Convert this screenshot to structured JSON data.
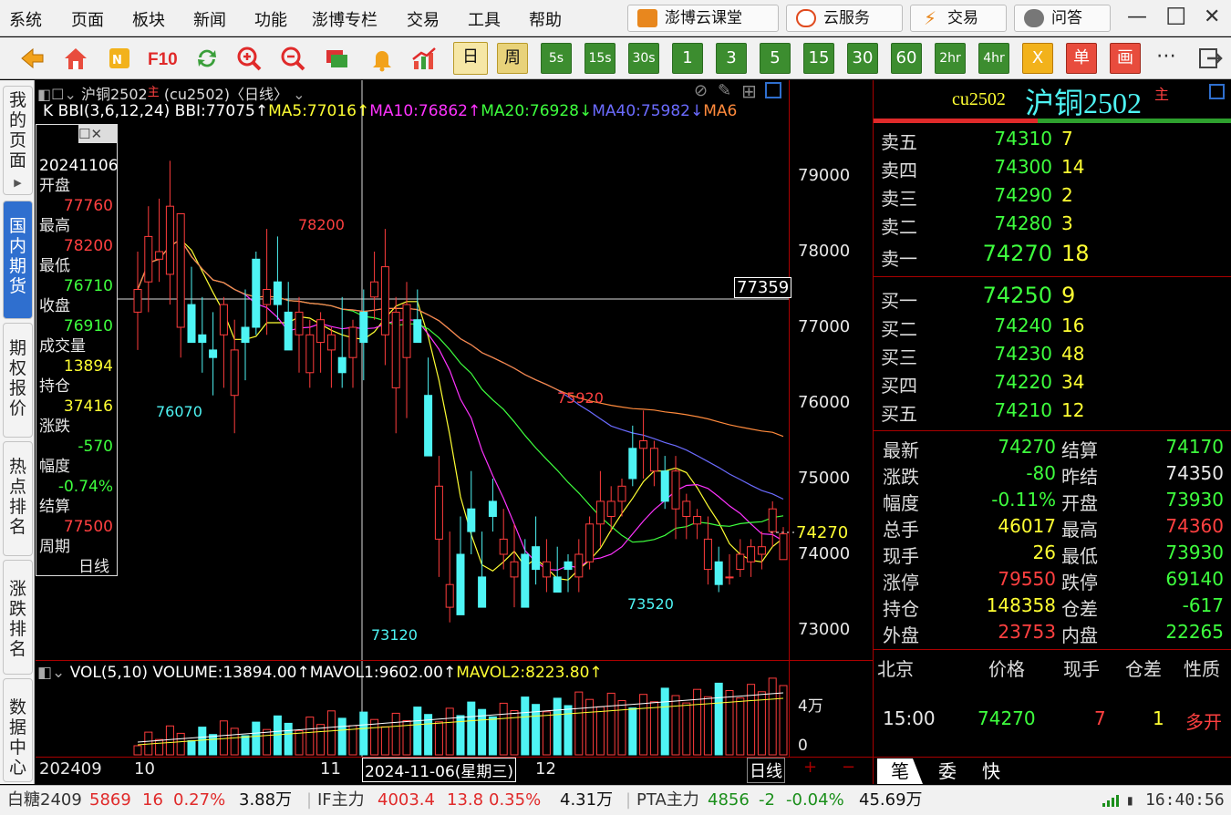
{
  "menu": [
    "系统",
    "页面",
    "板块",
    "新闻",
    "功能",
    "澎博专栏",
    "交易",
    "工具",
    "帮助"
  ],
  "top_buttons": {
    "ketang": "澎博云课堂",
    "yun": "云服务",
    "jiaoyi": "交易",
    "wenda": "问答"
  },
  "periods": [
    "日",
    "周",
    "5s",
    "15s",
    "30s",
    "1",
    "3",
    "5",
    "15",
    "30",
    "60",
    "2hr",
    "4hr",
    "X",
    "单",
    "画"
  ],
  "toolbar_icons": [
    "back-arrow-icon",
    "home-icon",
    "f10-news-icon",
    "f10-icon",
    "refresh-icon",
    "zoom-in-icon",
    "zoom-out-icon",
    "window-icon",
    "alert-bell-icon",
    "trend-icon"
  ],
  "sidebar": [
    "我的页面",
    "国内期货",
    "期权报价",
    "热点排名",
    "涨跌排名",
    "数据中心"
  ],
  "chart": {
    "header_title": "沪铜2502",
    "header_main": "主",
    "header_code": "(cu2502)",
    "header_period": "〈日线〉",
    "indicator_prefix": "K",
    "bbi": "BBI(3,6,12,24) BBI:77075↑",
    "ma5": "MA5:77016↑",
    "ma10": "MA10:76862↑",
    "ma20": "MA20:76928↓",
    "ma40": "MA40:75982↓",
    "ma_more": "MA6",
    "price_axis": [
      "79000",
      "78000",
      "77000",
      "76000",
      "75000",
      "74000",
      "73000"
    ],
    "cursor_price": "77359",
    "last_price": "74270",
    "annotations": {
      "high1": "78200",
      "low1": "76070",
      "high2": "75920",
      "low2": "73120",
      "low3": "73520"
    },
    "vol_header": {
      "vol": "VOL(5,10) VOLUME:13894.00↑",
      "mavol1": "MAVOL1:9602.00↑",
      "mavol2": "MAVOL2:8223.80↑"
    },
    "vol_axis": [
      "4万",
      "0"
    ],
    "date_axis": [
      "202409",
      "10",
      "11",
      "12"
    ],
    "cursor_date": "2024-11-06(星期三)",
    "period_label": "日线"
  },
  "chart_data": {
    "type": "candlestick",
    "title": "沪铜2502 (cu2502) 日线",
    "ylim": [
      72400,
      79900
    ],
    "ohlc": [
      [
        77200,
        78000,
        76700,
        77500
      ],
      [
        77600,
        78600,
        77200,
        78200
      ],
      [
        77900,
        78700,
        77600,
        78000
      ],
      [
        77700,
        79200,
        77300,
        78600
      ],
      [
        77000,
        78200,
        76600,
        78500
      ],
      [
        77300,
        77800,
        76900,
        76800
      ],
      [
        76900,
        77400,
        76400,
        76800
      ],
      [
        76700,
        77200,
        76100,
        76600
      ],
      [
        76900,
        77400,
        76200,
        77300
      ],
      [
        76100,
        77100,
        75600,
        76700
      ],
      [
        77000,
        77500,
        76300,
        76800
      ],
      [
        77900,
        78000,
        76900,
        77000
      ],
      [
        77300,
        78300,
        76900,
        77500
      ],
      [
        77600,
        78200,
        77100,
        77300
      ],
      [
        77200,
        77600,
        76700,
        76700
      ],
      [
        76900,
        77400,
        76400,
        77200
      ],
      [
        76400,
        77100,
        76200,
        76900
      ],
      [
        76800,
        77200,
        76400,
        77100
      ],
      [
        76700,
        77000,
        76200,
        76900
      ],
      [
        76600,
        77400,
        76200,
        76400
      ],
      [
        76600,
        77100,
        76200,
        77000
      ],
      [
        77200,
        77500,
        76300,
        76800
      ],
      [
        77400,
        78000,
        77100,
        77600
      ],
      [
        76900,
        78300,
        76500,
        77800
      ],
      [
        76200,
        77400,
        75600,
        77200
      ],
      [
        76600,
        77600,
        75800,
        77300
      ],
      [
        77100,
        77500,
        76800,
        76800
      ],
      [
        76100,
        76600,
        75400,
        75300
      ],
      [
        74200,
        75300,
        73700,
        74900
      ],
      [
        73300,
        74300,
        73100,
        73600
      ],
      [
        74000,
        74500,
        73300,
        73200
      ],
      [
        74600,
        75100,
        74000,
        74300
      ],
      [
        73700,
        74300,
        73400,
        73300
      ],
      [
        74700,
        75000,
        74300,
        74500
      ],
      [
        74000,
        74600,
        73800,
        74200
      ],
      [
        73700,
        74400,
        73300,
        73900
      ],
      [
        74000,
        74200,
        73400,
        73300
      ],
      [
        74100,
        74500,
        73600,
        73800
      ],
      [
        73700,
        74200,
        73500,
        73900
      ],
      [
        73700,
        74100,
        73600,
        73500
      ],
      [
        73900,
        74000,
        73500,
        73800
      ],
      [
        73700,
        74200,
        73500,
        74000
      ],
      [
        73900,
        74500,
        73800,
        74400
      ],
      [
        74400,
        75100,
        74100,
        74700
      ],
      [
        74500,
        74900,
        74300,
        74700
      ],
      [
        74700,
        75000,
        74500,
        74900
      ],
      [
        75400,
        75700,
        74900,
        75000
      ],
      [
        75400,
        75900,
        75000,
        75500
      ],
      [
        75100,
        75500,
        74900,
        75400
      ],
      [
        75100,
        75300,
        74600,
        74700
      ],
      [
        74600,
        75300,
        74200,
        75100
      ],
      [
        74500,
        74800,
        74200,
        74700
      ],
      [
        74400,
        74600,
        74200,
        74500
      ],
      [
        73800,
        74500,
        73600,
        74200
      ],
      [
        73900,
        74100,
        73500,
        73600
      ],
      [
        73700,
        74000,
        73600,
        73700
      ],
      [
        73800,
        74200,
        73700,
        74000
      ],
      [
        73900,
        74200,
        73700,
        74100
      ],
      [
        74000,
        74300,
        73800,
        74100
      ],
      [
        74300,
        74700,
        74100,
        74600
      ],
      [
        73930,
        74360,
        73930,
        74270
      ]
    ],
    "volume_max_label": "4万"
  },
  "right": {
    "code": "cu2502",
    "name": "沪铜2502",
    "main": "主",
    "sell": [
      {
        "label": "卖五",
        "price": "74310",
        "vol": "7"
      },
      {
        "label": "卖四",
        "price": "74300",
        "vol": "14"
      },
      {
        "label": "卖三",
        "price": "74290",
        "vol": "2"
      },
      {
        "label": "卖二",
        "price": "74280",
        "vol": "3"
      },
      {
        "label": "卖一",
        "price": "74270",
        "vol": "18"
      }
    ],
    "buy": [
      {
        "label": "买一",
        "price": "74250",
        "vol": "9"
      },
      {
        "label": "买二",
        "price": "74240",
        "vol": "16"
      },
      {
        "label": "买三",
        "price": "74230",
        "vol": "48"
      },
      {
        "label": "买四",
        "price": "74220",
        "vol": "34"
      },
      {
        "label": "买五",
        "price": "74210",
        "vol": "12"
      }
    ],
    "quote": [
      [
        "最新",
        "74270",
        "结算",
        "74170"
      ],
      [
        "涨跌",
        "-80",
        "昨结",
        "74350"
      ],
      [
        "幅度",
        "-0.11%",
        "开盘",
        "73930"
      ],
      [
        "总手",
        "46017",
        "最高",
        "74360"
      ],
      [
        "现手",
        "26",
        "最低",
        "73930"
      ],
      [
        "涨停",
        "79550",
        "跌停",
        "69140"
      ],
      [
        "持仓",
        "148358",
        "仓差",
        "-617"
      ],
      [
        "外盘",
        "23753",
        "内盘",
        "22265"
      ]
    ],
    "ticks_header": [
      "北京",
      "价格",
      "现手",
      "仓差",
      "性质"
    ],
    "tick": {
      "time": "15:00",
      "price": "74270",
      "vol": "7",
      "oi": "1",
      "nature": "多开"
    },
    "tabs": [
      "笔",
      "委",
      "快"
    ]
  },
  "info_box": {
    "date": "20241106",
    "open_label": "开盘",
    "open": "77760",
    "high_label": "最高",
    "high": "78200",
    "low_label": "最低",
    "low": "76710",
    "close_label": "收盘",
    "close": "76910",
    "vol_label": "成交量",
    "vol": "13894",
    "oi_label": "持仓",
    "oi": "37416",
    "chg_label": "涨跌",
    "chg": "-570",
    "pct_label": "幅度",
    "pct": "-0.74%",
    "settle_label": "结算",
    "settle": "77500",
    "period_label": "周期",
    "period": "日线"
  },
  "status": {
    "t1_name": "白糖2409",
    "t1_price": "5869",
    "t1_chg": "16",
    "t1_pct": "0.27%",
    "t1_vol": "3.88万",
    "t2_name": "IF主力",
    "t2_price": "4003.4",
    "t2_chg": "13.8",
    "t2_pct": "0.35%",
    "t2_vol": "4.31万",
    "t3_name": "PTA主力",
    "t3_price": "4856",
    "t3_chg": "-2",
    "t3_pct": "-0.04%",
    "t3_vol": "45.69万",
    "time": "16:40:56"
  }
}
